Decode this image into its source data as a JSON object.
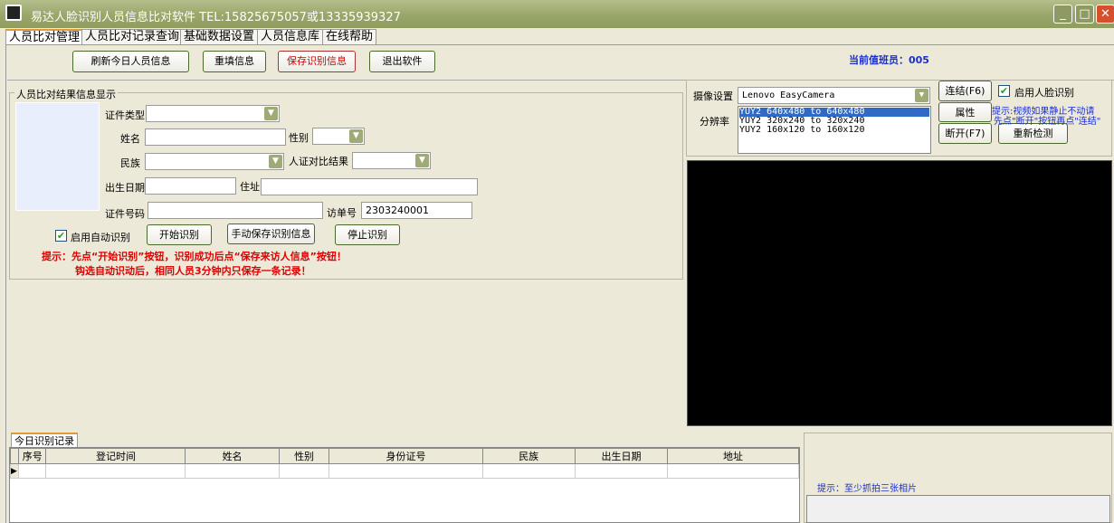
{
  "window": {
    "title": "易达人脸识别人员信息比对软件 TEL:15825675057或13335939327",
    "minimize": "_",
    "maximize": "□",
    "close": "✕"
  },
  "tabs": [
    "人员比对管理",
    "人员比对记录查询",
    "基础数据设置",
    "人员信息库",
    "在线帮助"
  ],
  "toolbar": {
    "refresh": "刷新今日人员信息",
    "refill": "重填信息",
    "save": "保存识别信息",
    "exit": "退出软件",
    "duty": "当前值班员：005"
  },
  "form": {
    "group_title": "人员比对结果信息显示",
    "id_type": "证件类型",
    "name": "姓名",
    "gender": "性别",
    "ethnicity": "民族",
    "match_result": "人证对比结果",
    "birth": "出生日期",
    "address": "住址",
    "id_number": "证件号码",
    "visit_no": "访单号",
    "visit_no_value": "2303240001",
    "auto": "启用自动识别",
    "start": "开始识别",
    "manual_save": "手动保存识别信息",
    "stop": "停止识别",
    "hint1": "提示：先点“开始识别”按钮，识别成功后点“保存来访人信息”按钮！",
    "hint2": "钩选自动识动后，相同人员3分钟内只保存一条记录！"
  },
  "camera": {
    "label": "摄像设置",
    "device": "Lenovo EasyCamera",
    "resolution_label": "分辨率",
    "resolutions": [
      "YUY2 640x480 to 640x480",
      "YUY2 320x240 to 320x240",
      "YUY2 160x120 to 160x120"
    ],
    "connect": "连结(F6)",
    "props": "属性",
    "disconnect": "断开(F7)",
    "redetect": "重新检测",
    "face_enable": "启用人脸识别",
    "hint1": "提示:视频如果静止不动请",
    "hint2": "先点\"断开\"按钮再点\"连结\""
  },
  "records": {
    "tab": "今日识别记录",
    "columns": [
      "序号",
      "登记时间",
      "姓名",
      "性别",
      "身份证号",
      "民族",
      "出生日期",
      "地址"
    ]
  },
  "photo": {
    "hint": "提示：至少抓拍三张相片"
  },
  "colors": {
    "accent_blue": "#1a2fd0",
    "hint_red": "#e00000"
  }
}
